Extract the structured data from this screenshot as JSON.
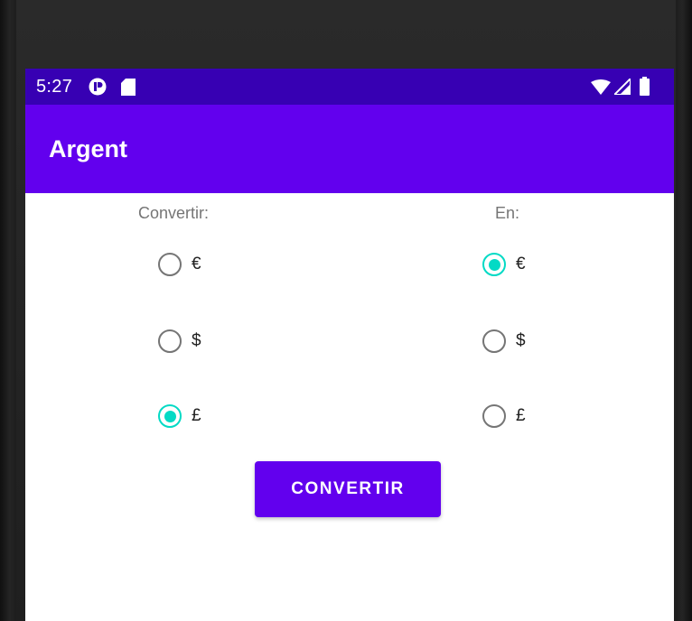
{
  "status_bar": {
    "time": "5:27",
    "left_icons": [
      "app-notification-icon",
      "sd-card-icon"
    ],
    "right_icons": [
      "wifi-icon",
      "signal-icon",
      "battery-icon"
    ],
    "color": "#3700b3"
  },
  "app_bar": {
    "title": "Argent",
    "color": "#6200ee"
  },
  "from_column": {
    "header": "Convertir:",
    "options": [
      {
        "label": "€",
        "checked": false
      },
      {
        "label": "$",
        "checked": false
      },
      {
        "label": "£",
        "checked": true
      }
    ]
  },
  "to_column": {
    "header": "En:",
    "options": [
      {
        "label": "€",
        "checked": true
      },
      {
        "label": "$",
        "checked": false
      },
      {
        "label": "£",
        "checked": false
      }
    ]
  },
  "convert_button": {
    "label": "CONVERTIR",
    "color": "#6200ee"
  },
  "accent_color": "#03dac5"
}
